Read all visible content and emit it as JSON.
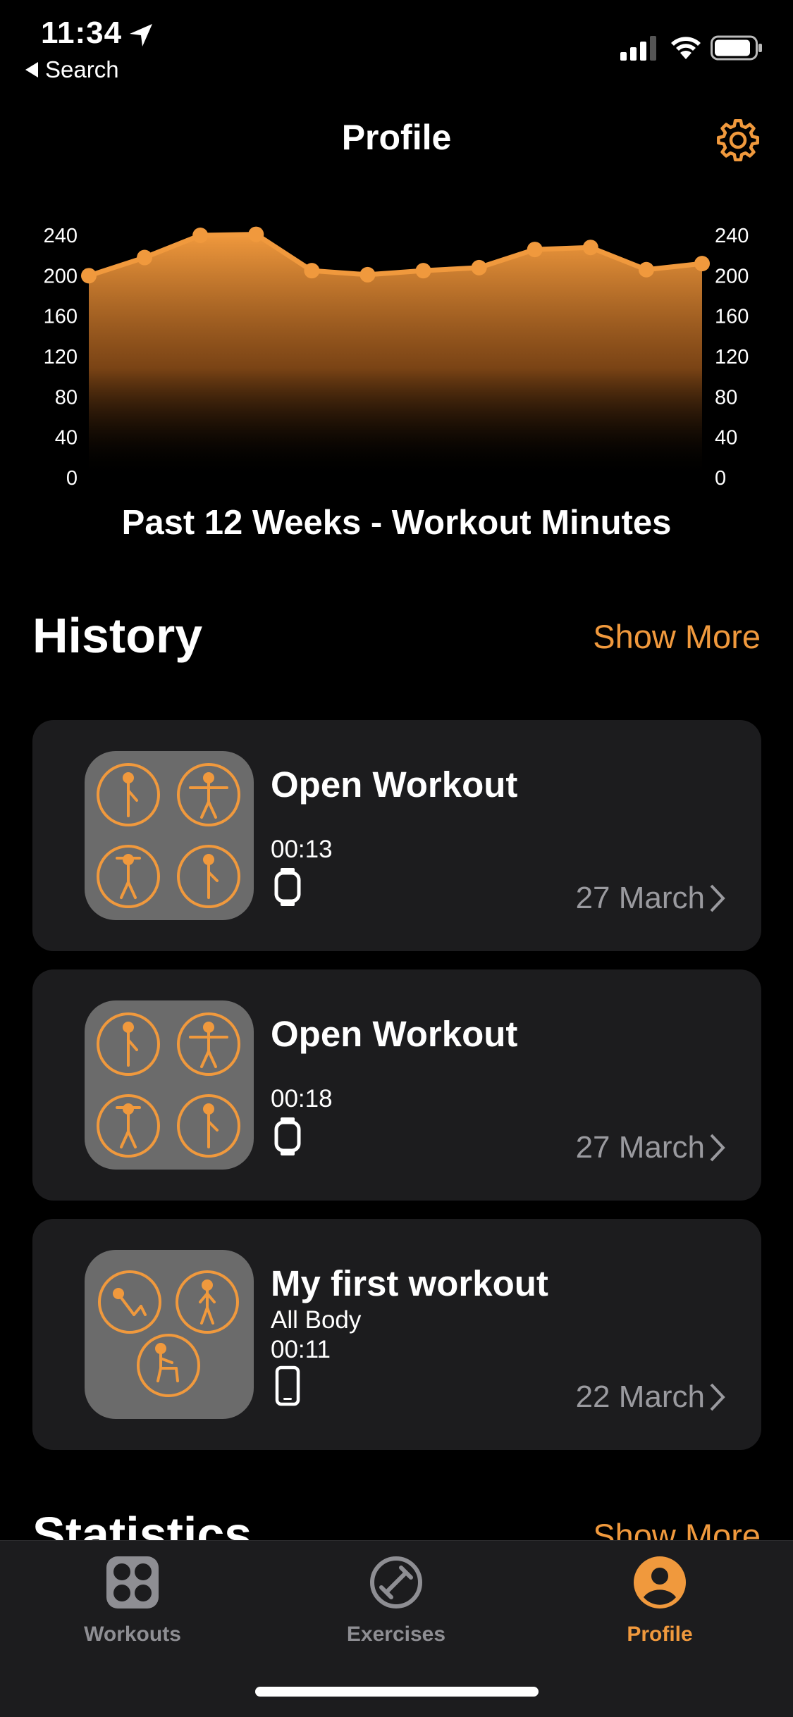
{
  "status_bar": {
    "time": "11:34",
    "back_label": "Search"
  },
  "header": {
    "title": "Profile",
    "settings_icon": "gear-icon"
  },
  "colors": {
    "accent": "#f0993d",
    "card": "#1c1c1e",
    "thumb": "#6b6b6b",
    "muted": "#9a9a9f"
  },
  "chart_data": {
    "type": "area",
    "title": "Past 12 Weeks - Workout Minutes",
    "x": [
      1,
      2,
      3,
      4,
      5,
      6,
      7,
      8,
      9,
      10,
      11,
      12
    ],
    "values": [
      200,
      218,
      240,
      241,
      205,
      201,
      205,
      208,
      226,
      228,
      206,
      212
    ],
    "ylim": [
      0,
      240
    ],
    "yticks": [
      "0",
      "40",
      "80",
      "120",
      "160",
      "200",
      "240"
    ],
    "grid": false,
    "axis_labels_both_sides": true
  },
  "history": {
    "title": "History",
    "show_more": "Show More",
    "items": [
      {
        "title": "Open Workout",
        "subtitle": "",
        "duration": "00:13",
        "device": "watch-icon",
        "date": "27 March"
      },
      {
        "title": "Open Workout",
        "subtitle": "",
        "duration": "00:18",
        "device": "watch-icon",
        "date": "27 March"
      },
      {
        "title": "My first workout",
        "subtitle": "All Body",
        "duration": "00:11",
        "device": "phone-icon",
        "date": "22 March"
      }
    ]
  },
  "statistics": {
    "title": "Statistics",
    "show_more": "Show More"
  },
  "tab_bar": {
    "tabs": [
      {
        "label": "Workouts",
        "icon": "grid-icon",
        "selected": false
      },
      {
        "label": "Exercises",
        "icon": "dumbbell-icon",
        "selected": false
      },
      {
        "label": "Profile",
        "icon": "person-icon",
        "selected": true
      }
    ]
  }
}
